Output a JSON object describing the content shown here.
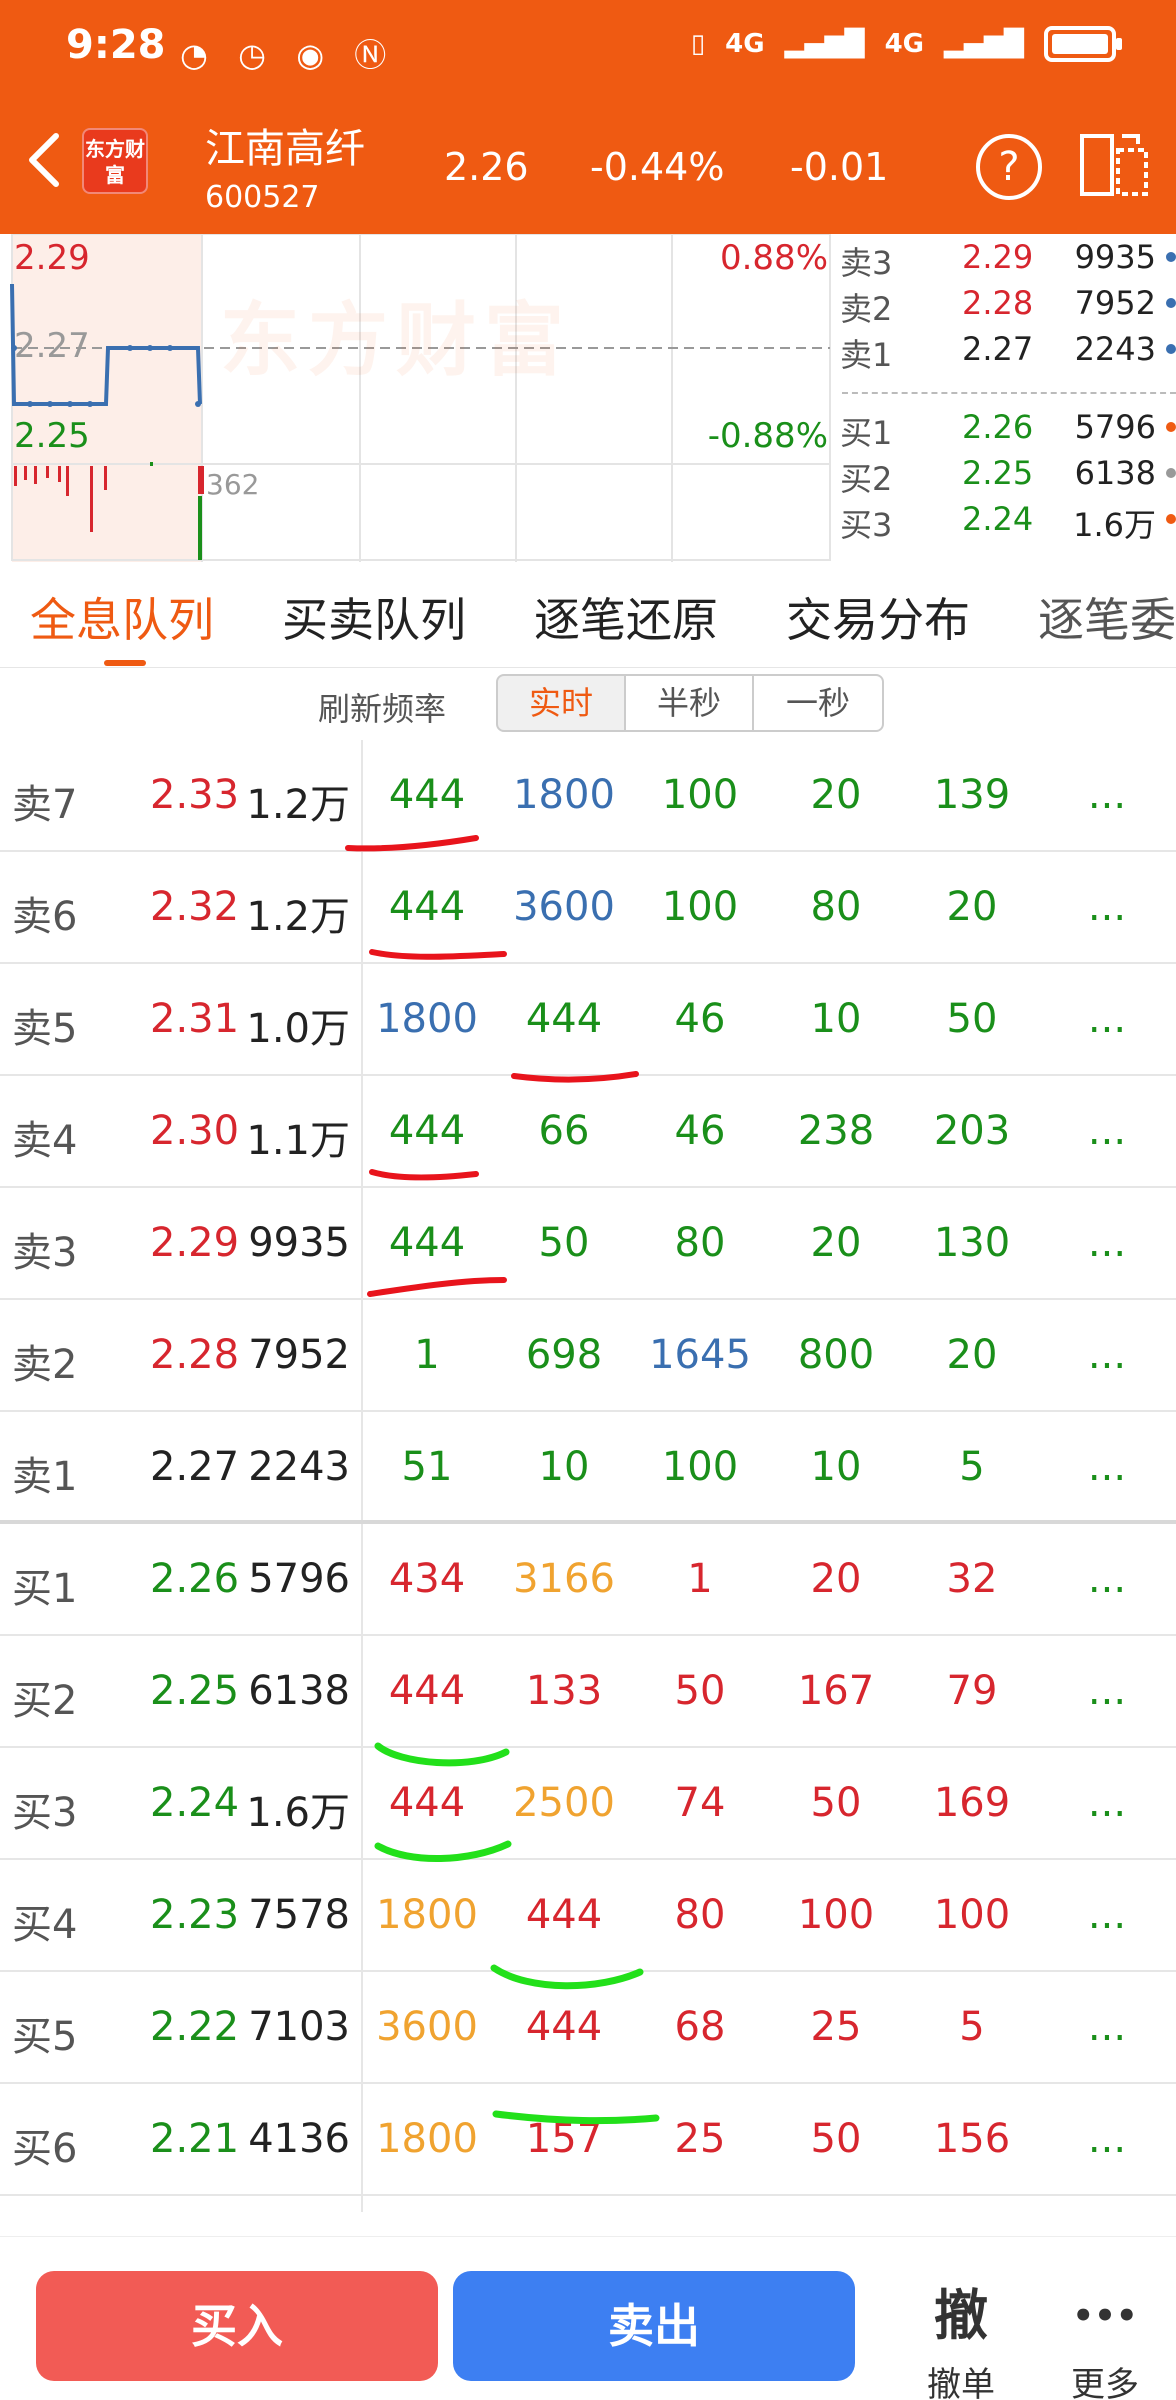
{
  "status_bar": {
    "time": "9:28",
    "signal_1": "4G",
    "signal_2": "4G"
  },
  "header": {
    "logo": "东方财富",
    "stock_name": "江南高纤",
    "stock_code": "600527",
    "price": "2.26",
    "change_pct": "-0.44%",
    "change": "-0.01",
    "help_label": "?"
  },
  "chart": {
    "y_high": "2.29",
    "y_mid": "2.27",
    "y_low": "2.25",
    "pct_high": "0.88%",
    "pct_low": "-0.88%",
    "volume_label": "362",
    "watermark": "东方财富"
  },
  "mini_book": [
    {
      "label": "卖3",
      "price": "2.29",
      "vol": "9935",
      "dot": "#3a6fb0",
      "price_color": "red"
    },
    {
      "label": "卖2",
      "price": "2.28",
      "vol": "7952",
      "dot": "#3a6fb0",
      "price_color": "red"
    },
    {
      "label": "卖1",
      "price": "2.27",
      "vol": "2243",
      "dot": "#3a6fb0",
      "price_color": "black"
    },
    {
      "label": "买1",
      "price": "2.26",
      "vol": "5796",
      "dot": "#ef5a12",
      "price_color": "green"
    },
    {
      "label": "买2",
      "price": "2.25",
      "vol": "6138",
      "dot": "#999999",
      "price_color": "green"
    },
    {
      "label": "买3",
      "price": "2.24",
      "vol": "1.6万",
      "dot": "#ef5a12",
      "price_color": "green"
    }
  ],
  "tabs": [
    "全息队列",
    "买卖队列",
    "逐笔还原",
    "交易分布",
    "逐笔委"
  ],
  "refresh": {
    "label": "刷新频率",
    "options": [
      "实时",
      "半秒",
      "一秒"
    ],
    "selected": "实时"
  },
  "queue": [
    {
      "label": "卖7",
      "price": "2.33",
      "vol": "1.2万",
      "q": [
        "444",
        "1800",
        "100",
        "20",
        "139"
      ],
      "qc": [
        "green",
        "blue",
        "green",
        "green",
        "green"
      ],
      "pc": "red"
    },
    {
      "label": "卖6",
      "price": "2.32",
      "vol": "1.2万",
      "q": [
        "444",
        "3600",
        "100",
        "80",
        "20"
      ],
      "qc": [
        "green",
        "blue",
        "green",
        "green",
        "green"
      ],
      "pc": "red"
    },
    {
      "label": "卖5",
      "price": "2.31",
      "vol": "1.0万",
      "q": [
        "1800",
        "444",
        "46",
        "10",
        "50"
      ],
      "qc": [
        "blue",
        "green",
        "green",
        "green",
        "green"
      ],
      "pc": "red"
    },
    {
      "label": "卖4",
      "price": "2.30",
      "vol": "1.1万",
      "q": [
        "444",
        "66",
        "46",
        "238",
        "203"
      ],
      "qc": [
        "green",
        "green",
        "green",
        "green",
        "green"
      ],
      "pc": "red"
    },
    {
      "label": "卖3",
      "price": "2.29",
      "vol": "9935",
      "q": [
        "444",
        "50",
        "80",
        "20",
        "130"
      ],
      "qc": [
        "green",
        "green",
        "green",
        "green",
        "green"
      ],
      "pc": "red"
    },
    {
      "label": "卖2",
      "price": "2.28",
      "vol": "7952",
      "q": [
        "1",
        "698",
        "1645",
        "800",
        "20"
      ],
      "qc": [
        "green",
        "green",
        "blue",
        "green",
        "green"
      ],
      "pc": "red"
    },
    {
      "label": "卖1",
      "price": "2.27",
      "vol": "2243",
      "q": [
        "51",
        "10",
        "100",
        "10",
        "5"
      ],
      "qc": [
        "green",
        "green",
        "green",
        "green",
        "green"
      ],
      "pc": "black"
    },
    {
      "label": "买1",
      "price": "2.26",
      "vol": "5796",
      "q": [
        "434",
        "3166",
        "1",
        "20",
        "32"
      ],
      "qc": [
        "red",
        "orange",
        "red",
        "red",
        "red"
      ],
      "pc": "green"
    },
    {
      "label": "买2",
      "price": "2.25",
      "vol": "6138",
      "q": [
        "444",
        "133",
        "50",
        "167",
        "79"
      ],
      "qc": [
        "red",
        "red",
        "red",
        "red",
        "red"
      ],
      "pc": "green"
    },
    {
      "label": "买3",
      "price": "2.24",
      "vol": "1.6万",
      "q": [
        "444",
        "2500",
        "74",
        "50",
        "169"
      ],
      "qc": [
        "red",
        "orange",
        "red",
        "red",
        "red"
      ],
      "pc": "green"
    },
    {
      "label": "买4",
      "price": "2.23",
      "vol": "7578",
      "q": [
        "1800",
        "444",
        "80",
        "100",
        "100"
      ],
      "qc": [
        "orange",
        "red",
        "red",
        "red",
        "red"
      ],
      "pc": "green"
    },
    {
      "label": "买5",
      "price": "2.22",
      "vol": "7103",
      "q": [
        "3600",
        "444",
        "68",
        "25",
        "5"
      ],
      "qc": [
        "orange",
        "red",
        "red",
        "red",
        "red"
      ],
      "pc": "green"
    },
    {
      "label": "买6",
      "price": "2.21",
      "vol": "4136",
      "q": [
        "1800",
        "157",
        "25",
        "50",
        "156"
      ],
      "qc": [
        "orange",
        "red",
        "red",
        "red",
        "red"
      ],
      "pc": "green"
    }
  ],
  "more_cell": "...",
  "footer": {
    "buy": "买入",
    "sell": "卖出",
    "cancel_icon": "撤",
    "cancel": "撤单",
    "more_icon": "•••",
    "more": "更多"
  }
}
